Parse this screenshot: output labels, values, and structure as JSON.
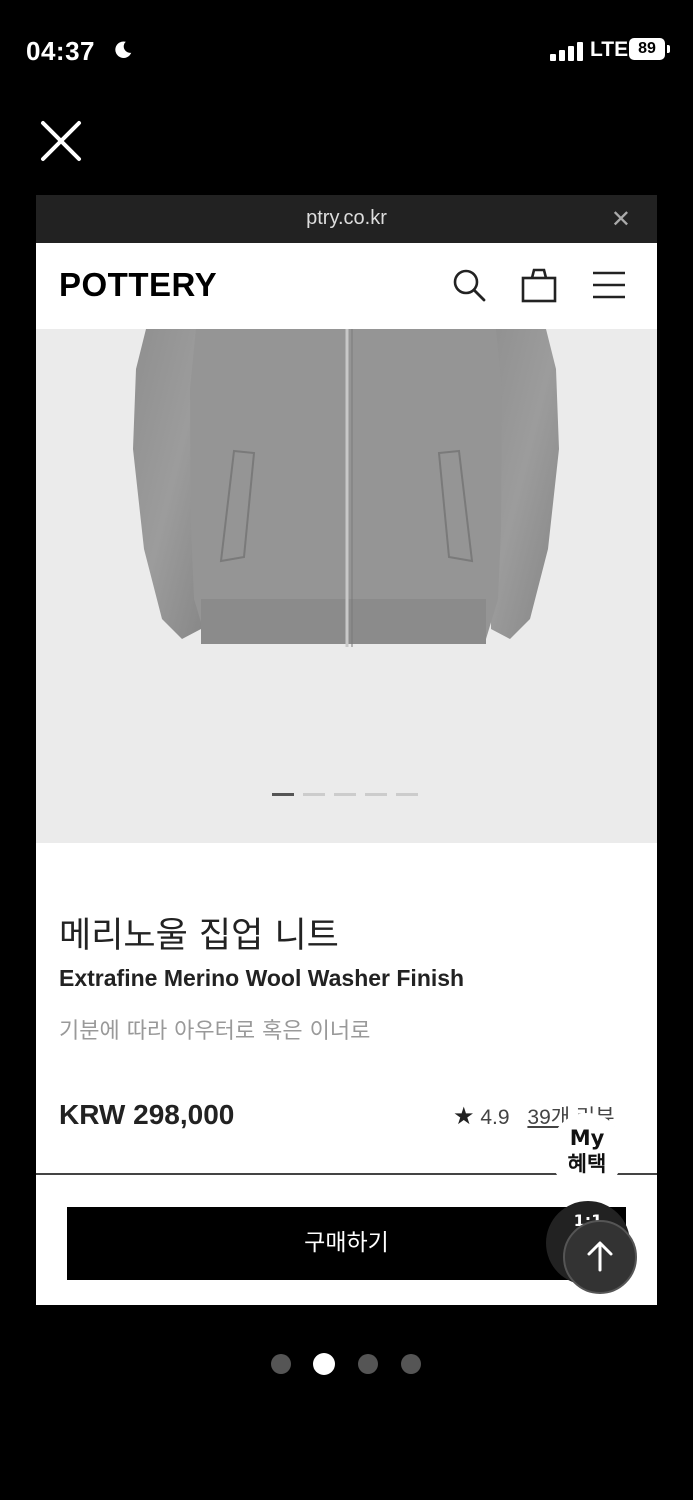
{
  "status_bar": {
    "time": "04:37",
    "network": "LTE",
    "battery": "89"
  },
  "browser": {
    "url": "ptry.co.kr"
  },
  "site": {
    "logo": "POTTERY"
  },
  "product": {
    "name_ko": "메리노울 집업 니트",
    "name_en": "Extrafine Merino Wool Washer Finish",
    "subtitle": "기분에 따라 아우터로 혹은 이너로",
    "price": "KRW 298,000",
    "rating": "4.9",
    "review_link": "39개 리뷰",
    "image_slide_count": 5,
    "active_image_slide": 1
  },
  "floating": {
    "my_benefit_line1": "My",
    "my_benefit_line2": "혜택",
    "chat_label": "1:1"
  },
  "buy_button_label": "구매하기",
  "pager": {
    "count": 4,
    "active_index": 2
  },
  "icons": [
    "moon-icon",
    "signal-icon",
    "battery-icon",
    "close-icon",
    "search-icon",
    "bag-icon",
    "menu-icon",
    "star-icon",
    "arrow-up-icon"
  ]
}
